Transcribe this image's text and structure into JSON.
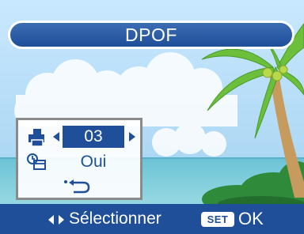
{
  "title_bar": {
    "title": "DPOF"
  },
  "panel": {
    "copies": {
      "icon": "printer-icon",
      "value": "03"
    },
    "date": {
      "icon": "date-stamp-icon",
      "value": "Oui"
    },
    "back": {
      "icon": "return-arrow-icon"
    }
  },
  "bottom_bar": {
    "nav_icon": "left-right-arrows-icon",
    "select_label": "Sélectionner",
    "set_badge": "SET",
    "ok_label": "OK"
  },
  "colors": {
    "ui_blue": "#1f4f99",
    "panel_border": "#8a8a8a",
    "sky": "#a9d3ee",
    "sea": "#7cc7d8",
    "palm_green": "#6bbf3b"
  }
}
